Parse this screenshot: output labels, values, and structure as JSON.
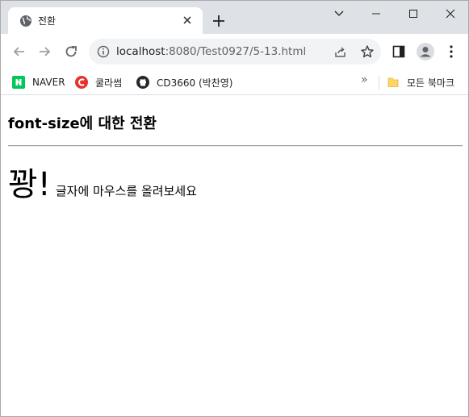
{
  "tab": {
    "title": "전환"
  },
  "address_bar": {
    "host": "localhost",
    "path": ":8080/Test0927/5-13.html"
  },
  "bookmarks": [
    {
      "label": "NAVER",
      "icon": "naver-icon",
      "color": "#03c75a"
    },
    {
      "label": "쿨라썸",
      "icon": "coupang-c-icon",
      "color": "#e5322d"
    },
    {
      "label": "CD3660 (박찬영)",
      "icon": "github-icon",
      "color": "#24292f"
    }
  ],
  "bookmarks_overflow": "»",
  "all_bookmarks": {
    "label": "모든 북마크",
    "icon": "folder-icon",
    "color": "#fdd663"
  },
  "page": {
    "heading": "font-size에 대한 전환",
    "big_text": "꽝!",
    "hint": "글자에 마우스를 올려보세요"
  }
}
